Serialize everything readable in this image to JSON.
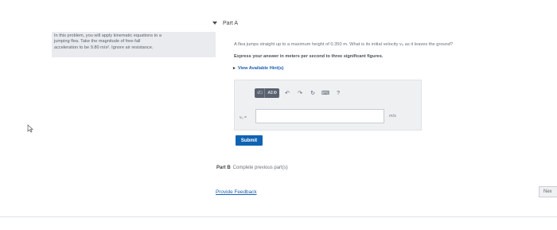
{
  "intro": {
    "line1": "In this problem, you will apply kinematic equations to a",
    "line2": "jumping flea. Take the magnitude of free-fall",
    "line3": "acceleration to be 9.80 m/s². Ignore air resistance."
  },
  "part_a": {
    "title": "Part A",
    "question": "A flea jumps straight up to a maximum height of 0.350 m. What is its initial velocity v₀ as it leaves the ground?",
    "instruction": "Express your answer in meters per second to three significant figures.",
    "hints_label": "View Available Hint(s)",
    "toolbar": {
      "templates_label": "√□",
      "symbols_label": "AΣΦ",
      "undo_icon": "↶",
      "redo_icon": "↷",
      "reset_icon": "↻",
      "keyboard_icon": "⌨",
      "help_label": "?"
    },
    "variable_label": "v₀ =",
    "answer_value": "",
    "unit_label": "m/s",
    "submit_label": "Submit"
  },
  "part_b": {
    "title": "Part B",
    "status": "Complete previous part(s)"
  },
  "feedback_link": "Provide Feedback",
  "next_label": "Nex"
}
